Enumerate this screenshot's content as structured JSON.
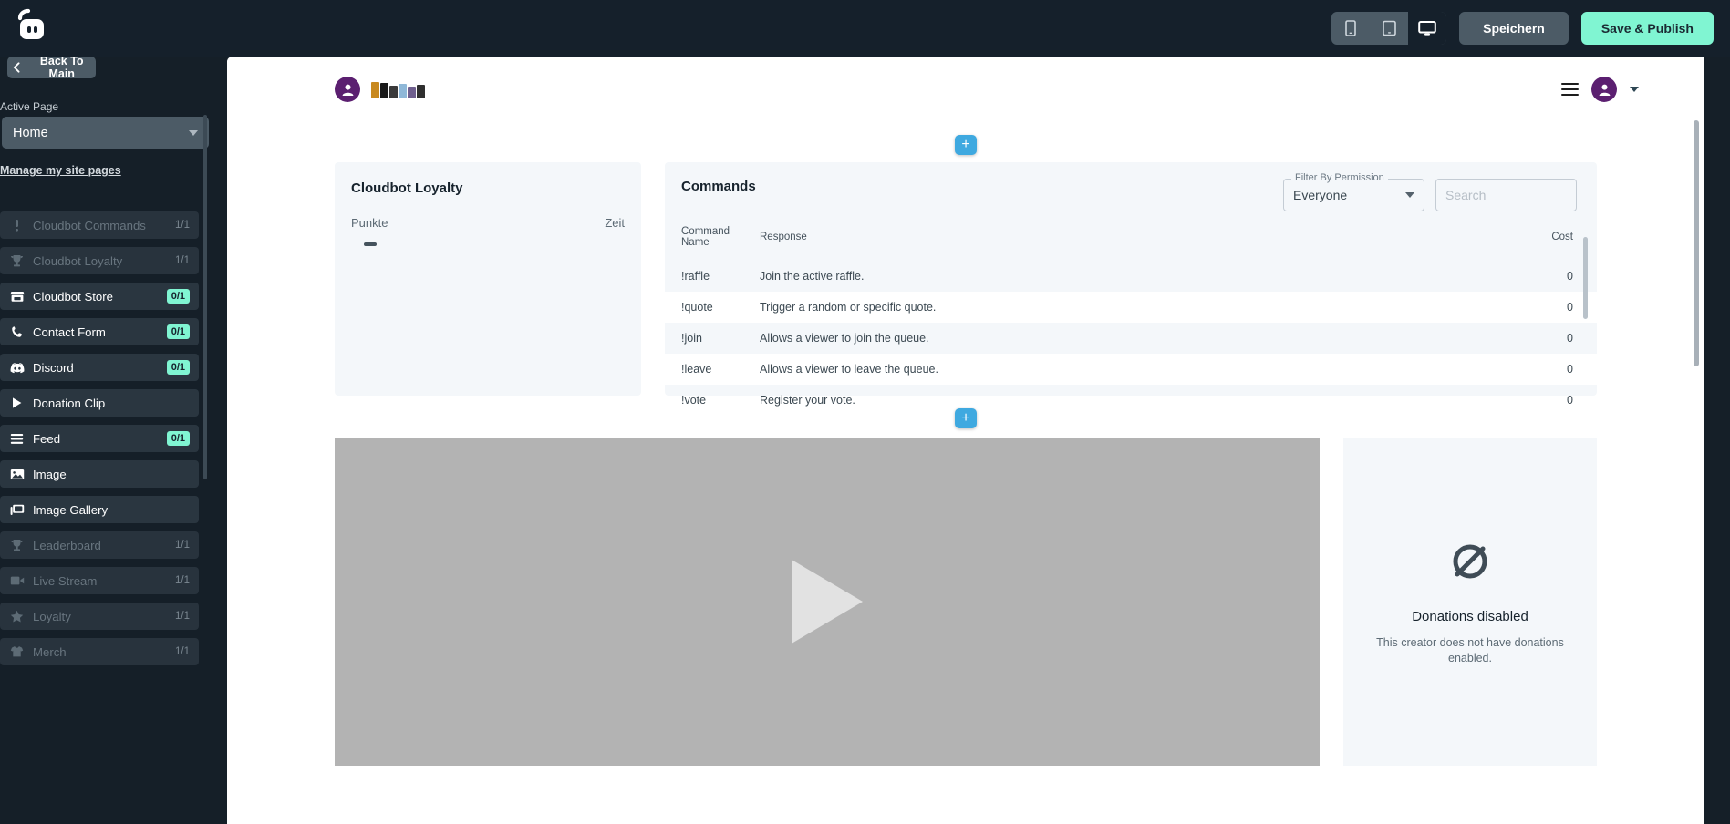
{
  "topbar": {
    "logo_icon": "streamlabs-logo",
    "devices": [
      {
        "name": "mobile",
        "icon": "mobile-icon",
        "active": false
      },
      {
        "name": "tablet",
        "icon": "tablet-icon",
        "active": false
      },
      {
        "name": "desktop",
        "icon": "desktop-icon",
        "active": true
      }
    ],
    "save_label": "Speichern",
    "publish_label": "Save & Publish"
  },
  "sidebar": {
    "back_label": "Back To Main",
    "active_page_label": "Active Page",
    "selected_page": "Home",
    "manage_link": "Manage my site pages",
    "items": [
      {
        "label": "Cloudbot Commands",
        "icon": "exclamation-icon",
        "badge": "1/1",
        "disabled": true
      },
      {
        "label": "Cloudbot Loyalty",
        "icon": "trophy-icon",
        "badge": "1/1",
        "disabled": true
      },
      {
        "label": "Cloudbot Store",
        "icon": "store-icon",
        "badge": "0/1",
        "disabled": false
      },
      {
        "label": "Contact Form",
        "icon": "phone-icon",
        "badge": "0/1",
        "disabled": false
      },
      {
        "label": "Discord",
        "icon": "discord-icon",
        "badge": "0/1",
        "disabled": false
      },
      {
        "label": "Donation Clip",
        "icon": "play-icon",
        "badge": "",
        "disabled": false
      },
      {
        "label": "Feed",
        "icon": "feed-icon",
        "badge": "0/1",
        "disabled": false
      },
      {
        "label": "Image",
        "icon": "image-icon",
        "badge": "",
        "disabled": false
      },
      {
        "label": "Image Gallery",
        "icon": "gallery-icon",
        "badge": "",
        "disabled": false
      },
      {
        "label": "Leaderboard",
        "icon": "trophy-icon",
        "badge": "1/1",
        "disabled": true
      },
      {
        "label": "Live Stream",
        "icon": "video-icon",
        "badge": "1/1",
        "disabled": true
      },
      {
        "label": "Loyalty",
        "icon": "star-icon",
        "badge": "1/1",
        "disabled": true
      },
      {
        "label": "Merch",
        "icon": "shirt-icon",
        "badge": "1/1",
        "disabled": true
      }
    ]
  },
  "site": {
    "header": {
      "avatar_icon": "user-avatar-icon",
      "menu_icon": "hamburger-icon",
      "chevron_icon": "chevron-down-icon"
    },
    "add_button_label": "+",
    "loyalty_panel": {
      "title": "Cloudbot Loyalty",
      "col_points": "Punkte",
      "col_time": "Zeit",
      "value_placeholder": "—"
    },
    "commands_panel": {
      "title": "Commands",
      "filter_label": "Filter By Permission",
      "filter_value": "Everyone",
      "search_placeholder": "Search",
      "columns": [
        "Command Name",
        "Response",
        "Cost"
      ],
      "rows": [
        {
          "command": "!raffle",
          "response": "Join the active raffle.",
          "cost": "0"
        },
        {
          "command": "!quote",
          "response": "Trigger a random or specific quote.",
          "cost": "0"
        },
        {
          "command": "!join",
          "response": "Allows a viewer to join the queue.",
          "cost": "0"
        },
        {
          "command": "!leave",
          "response": "Allows a viewer to leave the queue.",
          "cost": "0"
        },
        {
          "command": "!vote",
          "response": "Register your vote.",
          "cost": "0"
        }
      ]
    },
    "video_panel": {
      "play_icon": "play-button-icon"
    },
    "donations_panel": {
      "icon": "donations-disabled-icon",
      "title": "Donations disabled",
      "subtitle": "This creator does not have donations enabled."
    }
  },
  "colors": {
    "dark_bg": "#151f28",
    "topbar_bg": "#15202b",
    "accent_green": "#80f5d2",
    "accent_blue": "#3fa9e0",
    "panel_bg": "#f4f7fa",
    "avatar_purple": "#5b1f70"
  }
}
